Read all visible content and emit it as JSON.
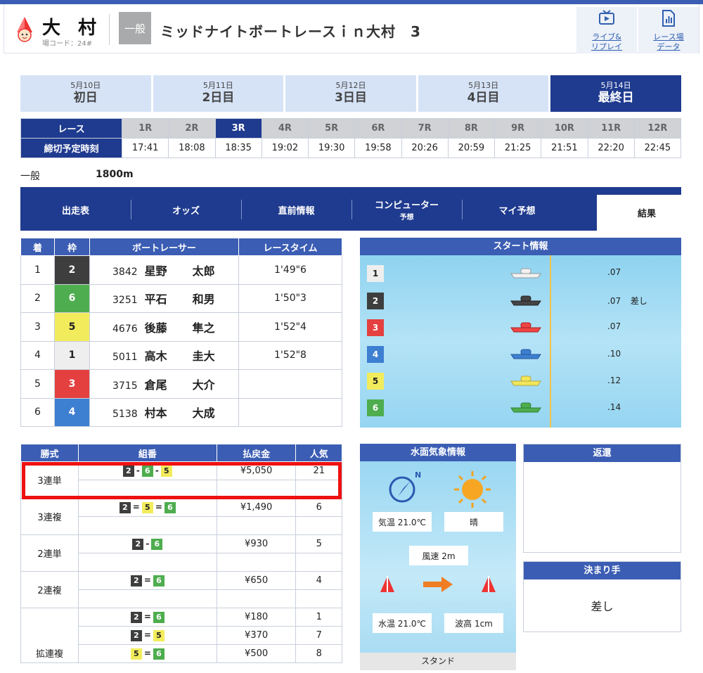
{
  "header": {
    "venue": "大 村",
    "venue_code": "場コード：24#",
    "grade": "一般",
    "race_title": "ミッドナイトボートレースｉｎ大村　3",
    "buttons": [
      {
        "line1": "ライブ&",
        "line2": "リプレイ",
        "icon": "video-play-icon"
      },
      {
        "line1": "レース場",
        "line2": "データ",
        "icon": "chart-document-icon"
      }
    ]
  },
  "days": [
    {
      "date": "5月10日",
      "label": "初日"
    },
    {
      "date": "5月11日",
      "label": "2日目"
    },
    {
      "date": "5月12日",
      "label": "3日目"
    },
    {
      "date": "5月13日",
      "label": "4日目"
    },
    {
      "date": "5月14日",
      "label": "最終日",
      "selected": true
    }
  ],
  "race_table": {
    "row1_header": "レース",
    "row2_header": "締切予定時刻",
    "races": [
      "1R",
      "2R",
      "3R",
      "4R",
      "5R",
      "6R",
      "7R",
      "8R",
      "9R",
      "10R",
      "11R",
      "12R"
    ],
    "selected_race": "3R",
    "times": [
      "17:41",
      "18:08",
      "18:35",
      "19:02",
      "19:30",
      "19:58",
      "20:26",
      "20:59",
      "21:25",
      "21:51",
      "22:20",
      "22:45"
    ]
  },
  "race_info": {
    "class": "一般",
    "distance": "1800m"
  },
  "nav_tabs": [
    {
      "label": "出走表"
    },
    {
      "label": "オッズ"
    },
    {
      "label": "直前情報"
    },
    {
      "label": "コンピューター",
      "sub": "予想"
    },
    {
      "label": "マイ予想"
    },
    {
      "label": "結果",
      "active": true
    }
  ],
  "results": {
    "headers": [
      "着",
      "枠",
      "ボートレーサー",
      "レースタイム"
    ],
    "rows": [
      {
        "rank": "1",
        "waku": "2",
        "reg": "3842",
        "sei": "星野",
        "mei": "太郎",
        "time": "1'49\"6"
      },
      {
        "rank": "2",
        "waku": "6",
        "reg": "3251",
        "sei": "平石",
        "mei": "和男",
        "time": "1'50\"3"
      },
      {
        "rank": "3",
        "waku": "5",
        "reg": "4676",
        "sei": "後藤",
        "mei": "隼之",
        "time": "1'52\"4"
      },
      {
        "rank": "4",
        "waku": "1",
        "reg": "5011",
        "sei": "高木",
        "mei": "圭大",
        "time": "1'52\"8"
      },
      {
        "rank": "5",
        "waku": "3",
        "reg": "3715",
        "sei": "倉尾",
        "mei": "大介",
        "time": ""
      },
      {
        "rank": "6",
        "waku": "4",
        "reg": "5138",
        "sei": "村本",
        "mei": "大成",
        "time": ""
      }
    ]
  },
  "start_info": {
    "title": "スタート情報",
    "lanes": [
      {
        "lane": "1",
        "st": ".07",
        "note": ""
      },
      {
        "lane": "2",
        "st": ".07",
        "note": "差し"
      },
      {
        "lane": "3",
        "st": ".07",
        "note": ""
      },
      {
        "lane": "4",
        "st": ".10",
        "note": ""
      },
      {
        "lane": "5",
        "st": ".12",
        "note": ""
      },
      {
        "lane": "6",
        "st": ".14",
        "note": ""
      }
    ]
  },
  "payouts": {
    "headers": [
      "勝式",
      "組番",
      "払戻金",
      "人気"
    ],
    "groups": [
      {
        "kind": "3連単",
        "entries": [
          {
            "combo": [
              "2",
              "6",
              "5"
            ],
            "sep": "-",
            "amount": "¥5,050",
            "pop": "21"
          }
        ]
      },
      {
        "kind": "3連複",
        "entries": [
          {
            "combo": [
              "2",
              "5",
              "6"
            ],
            "sep": "=",
            "amount": "¥1,490",
            "pop": "6"
          }
        ]
      },
      {
        "kind": "2連単",
        "entries": [
          {
            "combo": [
              "2",
              "6"
            ],
            "sep": "-",
            "amount": "¥930",
            "pop": "5"
          }
        ]
      },
      {
        "kind": "2連複",
        "entries": [
          {
            "combo": [
              "2",
              "6"
            ],
            "sep": "=",
            "amount": "¥650",
            "pop": "4"
          }
        ]
      },
      {
        "kind": "拡連複",
        "entries": [
          {
            "combo": [
              "2",
              "6"
            ],
            "sep": "=",
            "amount": "¥180",
            "pop": "1"
          },
          {
            "combo": [
              "2",
              "5"
            ],
            "sep": "=",
            "amount": "¥370",
            "pop": "7"
          },
          {
            "combo": [
              "5",
              "6"
            ],
            "sep": "=",
            "amount": "¥500",
            "pop": "8"
          }
        ]
      }
    ]
  },
  "weather": {
    "title": "水面気象情報",
    "wind_direction_label": "N",
    "air_temp": "気温 21.0℃",
    "condition": "晴",
    "wind_speed": "風速 2m",
    "water_temp": "水温 21.0℃",
    "wave_height": "波高 1cm",
    "stand_label": "スタンド"
  },
  "refund": {
    "title": "返還",
    "value": ""
  },
  "kimarite": {
    "title": "決まり手",
    "value": "差し"
  },
  "colors": {
    "navy": "#1f3b8f",
    "blue": "#3b5db3",
    "light": "#d6e3f6",
    "highlight": "#e11111"
  }
}
